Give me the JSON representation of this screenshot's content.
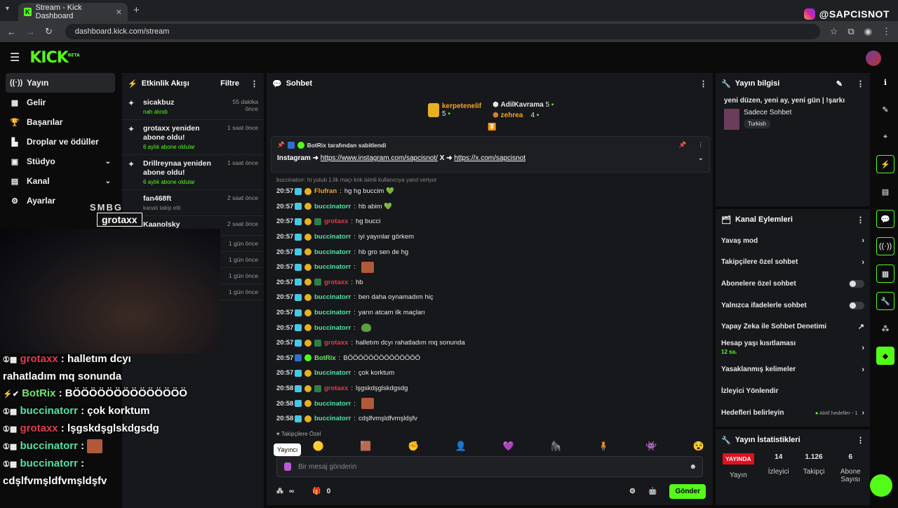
{
  "browser": {
    "tab_title": "Stream - Kick Dashboard",
    "url": "dashboard.kick.com/stream",
    "insta_handle": "@SAPCISNOT"
  },
  "logo": {
    "text": "KICK",
    "beta": "BETA"
  },
  "nav": [
    {
      "label": "Yayın",
      "icon": "broadcast-icon"
    },
    {
      "label": "Gelir",
      "icon": "money-icon"
    },
    {
      "label": "Başarılar",
      "icon": "trophy-icon"
    },
    {
      "label": "Droplar ve ödüller",
      "icon": "drops-icon"
    },
    {
      "label": "Stüdyo",
      "icon": "studio-icon"
    },
    {
      "label": "Kanal",
      "icon": "channel-icon"
    },
    {
      "label": "Ayarlar",
      "icon": "gear-icon"
    }
  ],
  "activity": {
    "title": "Etkinlik Akışı",
    "filter": "Filtre",
    "items": [
      {
        "title": "sicakbuz",
        "sub": "nah alındı",
        "time": "55 dakika önce"
      },
      {
        "title": "grotaxx yeniden abone oldu!",
        "sub": "6 aylık abone oldular",
        "time": "1 saat önce"
      },
      {
        "title": "Drillreynaa yeniden abone oldu!",
        "sub": "6 aylık abone oldular",
        "time": "1 saat önce"
      },
      {
        "title": "fan468ft",
        "sub": "kanalı takip etti",
        "time": "2 saat önce"
      },
      {
        "title": "Kaanolsky",
        "sub": "",
        "time": "2 saat önce"
      },
      {
        "title": "",
        "sub": "",
        "time": "1 gün önce"
      },
      {
        "title": "",
        "sub": "",
        "time": "1 gün önce"
      },
      {
        "title": "",
        "sub": "",
        "time": "1 gün önce"
      },
      {
        "title": "",
        "sub": "",
        "time": "1 gün önce"
      }
    ]
  },
  "chat": {
    "title": "Sohbet",
    "leaders": [
      {
        "name": "kerpetenelif",
        "count": "5"
      },
      {
        "name": "AdilKavrama",
        "count": "5"
      },
      {
        "name": "zehrea",
        "count": "4"
      }
    ],
    "pinned": {
      "by": "BotRix tarafından sabitlendi",
      "prefix": "Instagram ➜ ",
      "link1": "https://www.instagram.com/sapcisnot/",
      "mid": " X ➜ ",
      "link2": "https://x.com/sapcisnot"
    },
    "reply_hint": "buccinatorr: hi yutub 1.lik maçı knk isimli kullanıcıya yanıt veriyor",
    "messages": [
      {
        "t": "20:57",
        "u": "Flufran",
        "c": "u-orange",
        "m": "hg hg buccim 💚"
      },
      {
        "t": "20:57",
        "u": "buccinatorr",
        "c": "u-green",
        "m": "hb abim 💚"
      },
      {
        "t": "20:57",
        "u": "grotaxx",
        "c": "u-red",
        "m": "hg bucci"
      },
      {
        "t": "20:57",
        "u": "buccinatorr",
        "c": "u-green",
        "m": "iyi yayınlar görkem"
      },
      {
        "t": "20:57",
        "u": "buccinatorr",
        "c": "u-green",
        "m": "hb gro sen de hg"
      },
      {
        "t": "20:57",
        "u": "buccinatorr",
        "c": "u-green",
        "m": ""
      },
      {
        "t": "20:57",
        "u": "grotaxx",
        "c": "u-red",
        "m": "hb"
      },
      {
        "t": "20:57",
        "u": "buccinatorr",
        "c": "u-green",
        "m": "ben daha oynamadım hiç"
      },
      {
        "t": "20:57",
        "u": "buccinatorr",
        "c": "u-green",
        "m": "yarın atcam ilk maçları"
      },
      {
        "t": "20:57",
        "u": "buccinatorr",
        "c": "u-green",
        "m": ""
      },
      {
        "t": "20:57",
        "u": "grotaxx",
        "c": "u-red",
        "m": "halletım dcyı rahatladım mq sonunda"
      },
      {
        "t": "20:57",
        "u": "BotRix",
        "c": "u-bot",
        "m": "BÖÖÖÖÖÖÖÖÖÖÖÖÖÖ"
      },
      {
        "t": "20:57",
        "u": "buccinatorr",
        "c": "u-green",
        "m": "çok korktum"
      },
      {
        "t": "20:58",
        "u": "grotaxx",
        "c": "u-red",
        "m": "lşgskdşglskdgsdg"
      },
      {
        "t": "20:58",
        "u": "buccinatorr",
        "c": "u-green",
        "m": ""
      },
      {
        "t": "20:58",
        "u": "buccinatorr",
        "c": "u-green",
        "m": "cdşlfvmşldfvmşldşfv"
      }
    ],
    "followers_only": "Takipçilere Özel",
    "tooltip": "Yayıncı",
    "placeholder": "Bir mesaj gönderin",
    "infinity": "∞",
    "count0": "0",
    "send": "Gönder"
  },
  "info": {
    "title": "Yayın bilgisi",
    "stream_title": "yeni düzen, yeni ay, yeni gün | !şarkı",
    "category": "Sadece Sohbet",
    "tag": "Turkish"
  },
  "actions": {
    "title": "Kanal Eylemleri",
    "items": [
      {
        "label": "Yavaş mod",
        "type": "chev"
      },
      {
        "label": "Takipçilere özel sohbet",
        "type": "chev"
      },
      {
        "label": "Abonelere özel sohbet",
        "type": "toggle"
      },
      {
        "label": "Yalnızca ifadelerle sohbet",
        "type": "toggle"
      },
      {
        "label": "Yapay Zeka ile Sohbet Denetimi",
        "type": "ext"
      },
      {
        "label": "Hesap yaşı kısıtlaması",
        "type": "chev",
        "sub": "12 sa."
      },
      {
        "label": "Yasaklanmış kelimeler",
        "type": "chev"
      },
      {
        "label": "İzleyici Yönlendir",
        "type": "none"
      },
      {
        "label": "Hedefleri belirleyin",
        "type": "goal",
        "sub": "Aktif hedefler - 1"
      }
    ]
  },
  "stats": {
    "title": "Yayın İstatistikleri",
    "live": "YAYINDA",
    "live_label": "Yayın",
    "viewers": "14",
    "viewers_label": "İzleyici",
    "followers": "1.126",
    "followers_label": "Takipçi",
    "subs": "6",
    "subs_label": "Abone Sayısı"
  },
  "overlay": {
    "sticker_top": "SMBG",
    "sticker_name": "grotaxx",
    "lines": [
      {
        "u": "grotaxx",
        "c": "r",
        "m": " : halletım dcyı"
      },
      {
        "u": "",
        "c": "",
        "m": "rahatladım mq sonunda"
      },
      {
        "u": "BotRix",
        "c": "bot",
        "m": " : BÖÖÖÖÖÖÖÖÖÖÖÖÖÖ"
      },
      {
        "u": "buccinatorr",
        "c": "g",
        "m": " : çok korktum"
      },
      {
        "u": "grotaxx",
        "c": "r",
        "m": " : lşgskdşglskdgsdg"
      },
      {
        "u": "buccinatorr",
        "c": "g",
        "m": " :"
      },
      {
        "u": "buccinatorr",
        "c": "g",
        "m": " :"
      },
      {
        "u": "",
        "c": "",
        "m": "cdşlfvmşldfvmşldşfv"
      }
    ]
  }
}
